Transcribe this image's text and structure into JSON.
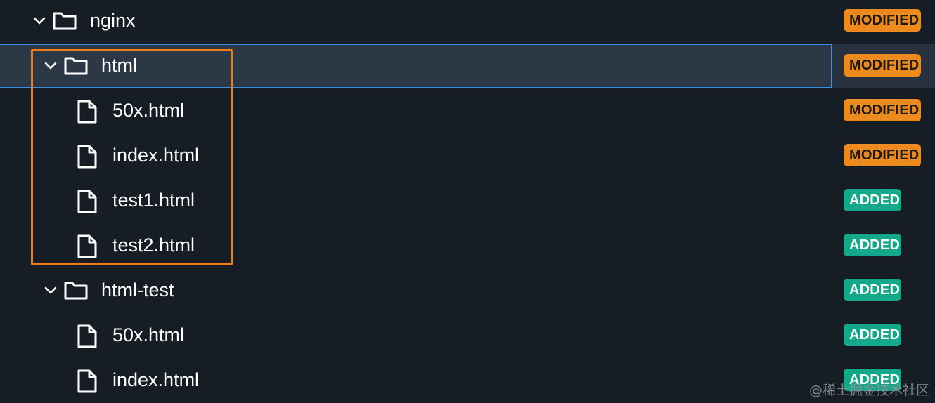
{
  "tree": {
    "rows": [
      {
        "type": "folder",
        "label": "nginx",
        "status": "MODIFIED",
        "status_kind": "modified",
        "depth": 0,
        "expanded": true,
        "selected": false
      },
      {
        "type": "folder",
        "label": "html",
        "status": "MODIFIED",
        "status_kind": "modified",
        "depth": 1,
        "expanded": true,
        "selected": true
      },
      {
        "type": "file",
        "label": "50x.html",
        "status": "MODIFIED",
        "status_kind": "modified",
        "depth": 2
      },
      {
        "type": "file",
        "label": "index.html",
        "status": "MODIFIED",
        "status_kind": "modified",
        "depth": 2
      },
      {
        "type": "file",
        "label": "test1.html",
        "status": "ADDED",
        "status_kind": "added",
        "depth": 2
      },
      {
        "type": "file",
        "label": "test2.html",
        "status": "ADDED",
        "status_kind": "added",
        "depth": 2
      },
      {
        "type": "folder",
        "label": "html-test",
        "status": "ADDED",
        "status_kind": "added",
        "depth": 1,
        "expanded": true,
        "selected": false
      },
      {
        "type": "file",
        "label": "50x.html",
        "status": "ADDED",
        "status_kind": "added",
        "depth": 2
      },
      {
        "type": "file",
        "label": "index.html",
        "status": "ADDED",
        "status_kind": "added",
        "depth": 2
      }
    ]
  },
  "colors": {
    "background": "#171d25",
    "selected_row": "#2c3846",
    "selection_border": "#3d8fe0",
    "highlight_box": "#f07c16",
    "modified_badge": "#ed8a1d",
    "added_badge": "#13a88a"
  },
  "icons": {
    "folder": "folder-icon",
    "file": "file-icon",
    "expand": "chevron-down-icon"
  },
  "watermark": "@稀土掘金技术社区"
}
